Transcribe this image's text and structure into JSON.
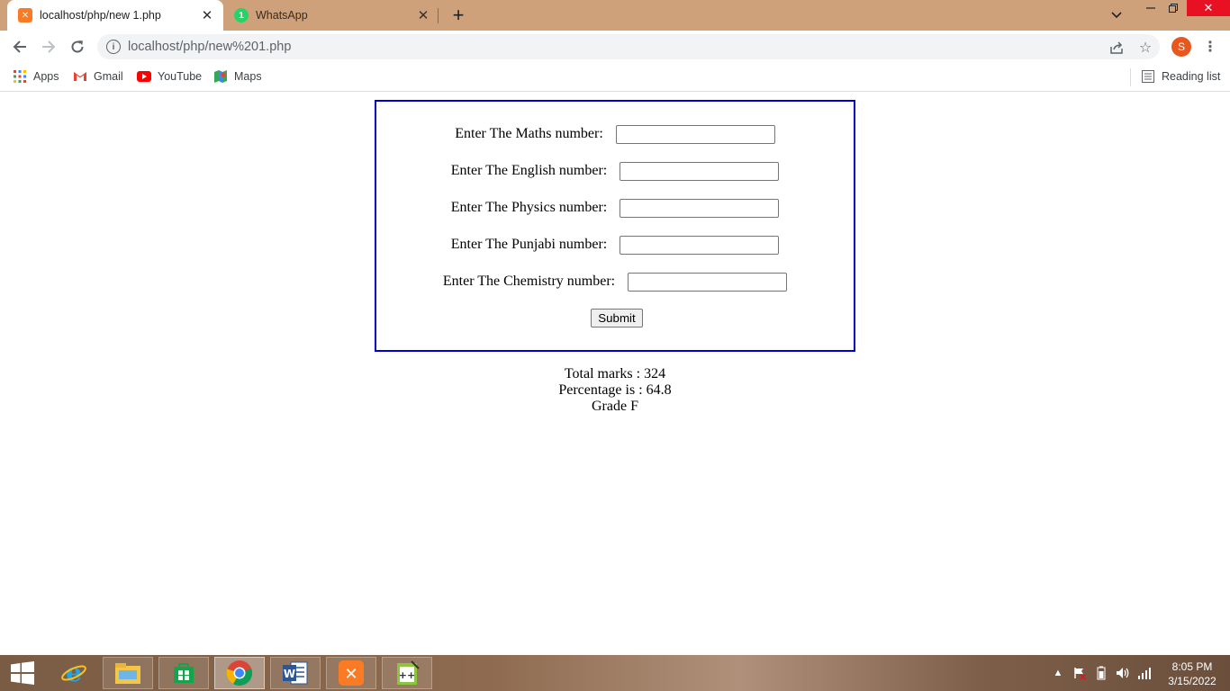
{
  "browser": {
    "tabs": [
      {
        "title": "localhost/php/new 1.php",
        "active": true,
        "icon": "xampp-icon"
      },
      {
        "title": "WhatsApp",
        "active": false,
        "icon": "whatsapp-icon"
      }
    ],
    "url": "localhost/php/new%201.php",
    "profile_initial": "S",
    "bookmarks": [
      {
        "label": "Apps",
        "icon": "apps-grid-icon"
      },
      {
        "label": "Gmail",
        "icon": "gmail-icon"
      },
      {
        "label": "YouTube",
        "icon": "youtube-icon"
      },
      {
        "label": "Maps",
        "icon": "maps-icon"
      }
    ],
    "reading_list": "Reading list",
    "accent_colors": {
      "tabstrip": "#cfa17a",
      "close": "#e81123",
      "profile": "#e8571e"
    }
  },
  "form": {
    "fields": [
      {
        "label": "Enter The Maths number:",
        "value": ""
      },
      {
        "label": "Enter The English number:",
        "value": ""
      },
      {
        "label": "Enter The Physics number:",
        "value": ""
      },
      {
        "label": "Enter The Punjabi number:",
        "value": ""
      },
      {
        "label": "Enter The Chemistry number:",
        "value": ""
      }
    ],
    "submit_label": "Submit",
    "border_color": "#0000cd"
  },
  "result": {
    "total": "Total marks : 324",
    "percentage": "Percentage is : 64.8",
    "grade": "Grade F"
  },
  "taskbar": {
    "apps": [
      "start-icon",
      "internet-explorer-icon",
      "file-explorer-icon",
      "store-icon",
      "chrome-icon",
      "word-icon",
      "xampp-icon",
      "notepad-icon"
    ],
    "time": "8:05 PM",
    "date": "3/15/2022"
  }
}
